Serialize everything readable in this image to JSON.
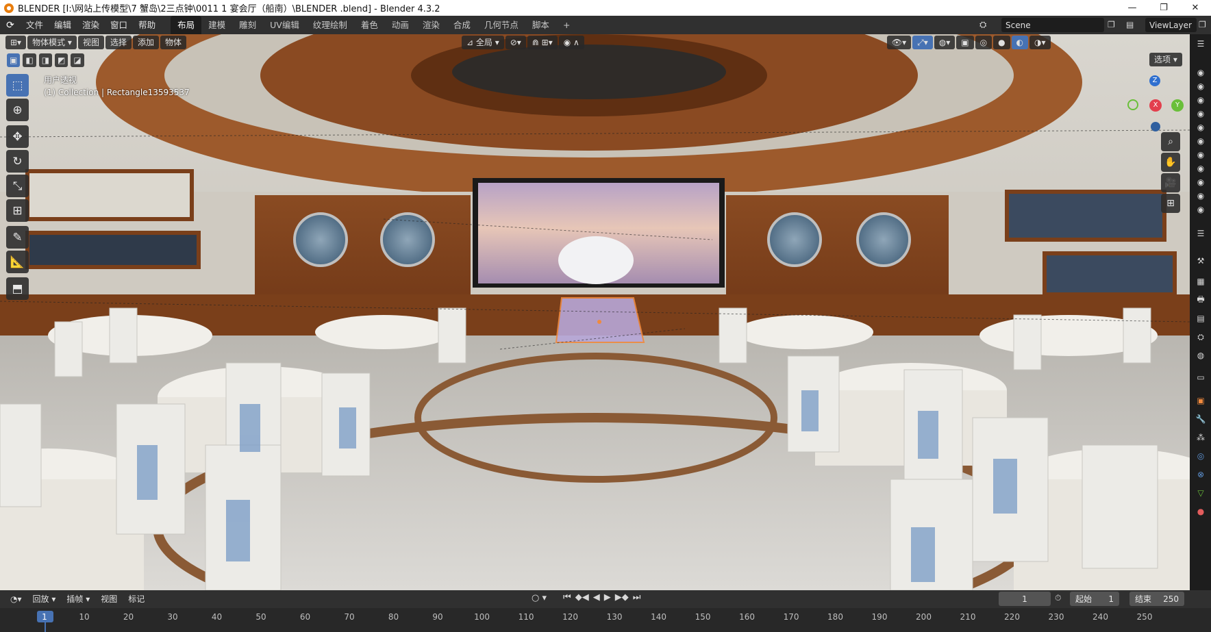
{
  "window": {
    "title": "BLENDER  [I:\\网站上传模型\\7 蟹岛\\2三点钟\\0011 1 宴会厅（船南）\\BLENDER .blend] - Blender 4.3.2",
    "controls": [
      "—",
      "❐",
      "✕"
    ]
  },
  "menu": [
    "文件",
    "编辑",
    "渲染",
    "窗口",
    "帮助"
  ],
  "workspaces": [
    "布局",
    "建模",
    "雕刻",
    "UV编辑",
    "纹理绘制",
    "着色",
    "动画",
    "渲染",
    "合成",
    "几何节点",
    "脚本",
    "+"
  ],
  "active_workspace": "布局",
  "scene": {
    "label": "Scene",
    "viewlayer": "ViewLayer"
  },
  "viewport_header": {
    "mode": "物体模式",
    "items": [
      "视图",
      "选择",
      "添加",
      "物体"
    ],
    "orientation": "全局",
    "options": "选项"
  },
  "viewport_info": {
    "line1": "用户透视",
    "line2": "(1) Collection | Rectangle13593537"
  },
  "gizmo": {
    "z": "Z",
    "x": "X",
    "y": "Y"
  },
  "tools": [
    "select-box",
    "cursor",
    "move",
    "rotate",
    "scale",
    "transform",
    "annotate",
    "measure",
    "add-cube"
  ],
  "timeline_header": {
    "items": [
      "回放",
      "插帧",
      "视图",
      "标记"
    ],
    "current_frame": "1",
    "start_label": "起始",
    "start": "1",
    "end_label": "结束",
    "end": "250"
  },
  "timeline_ticks": [
    "1",
    "10",
    "20",
    "30",
    "40",
    "50",
    "60",
    "70",
    "80",
    "90",
    "100",
    "110",
    "120",
    "130",
    "140",
    "150",
    "160",
    "170",
    "180",
    "190",
    "200",
    "210",
    "220",
    "230",
    "240",
    "250"
  ],
  "colors": {
    "accent": "#4772b3",
    "selection": "#f08a3e",
    "header": "#303030"
  }
}
